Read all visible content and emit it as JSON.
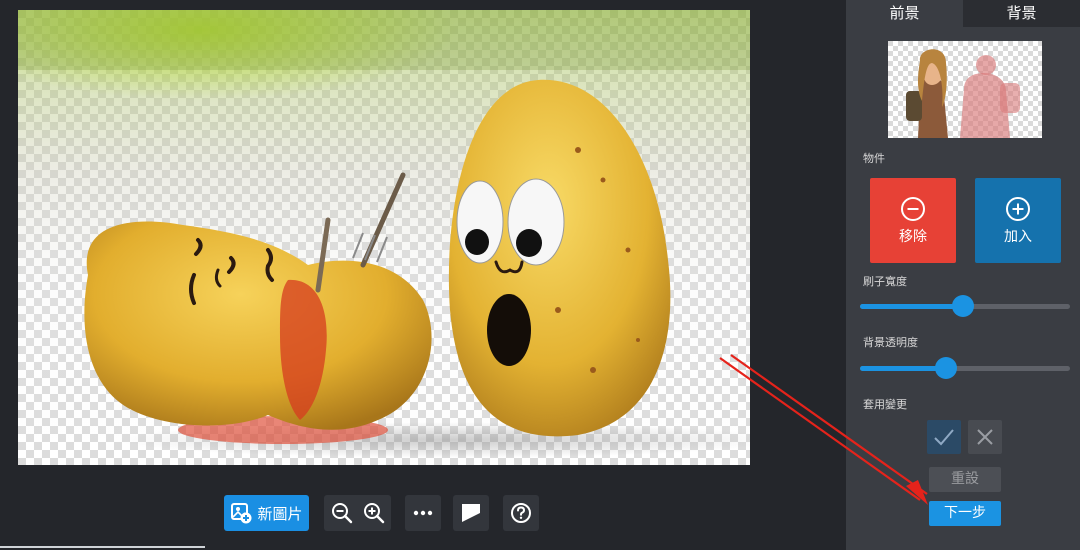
{
  "panel": {
    "tabs": [
      {
        "label": "前景"
      },
      {
        "label": "背景"
      }
    ],
    "object_label": "物件",
    "remove_button": "移除",
    "add_button": "加入",
    "brush_width_label": "刷子寬度",
    "brush_width_value": 0.49,
    "bg_opacity_label": "背景透明度",
    "bg_opacity_value": 0.41,
    "apply_changes_label": "套用變更",
    "reset_button": "重設",
    "next_button": "下一步"
  },
  "toolbar": {
    "new_image_label": "新圖片"
  },
  "colors": {
    "accent": "#1b93e2",
    "remove": "#e74136",
    "add": "#1572ad",
    "annotation_arrow": "#e5231b"
  }
}
